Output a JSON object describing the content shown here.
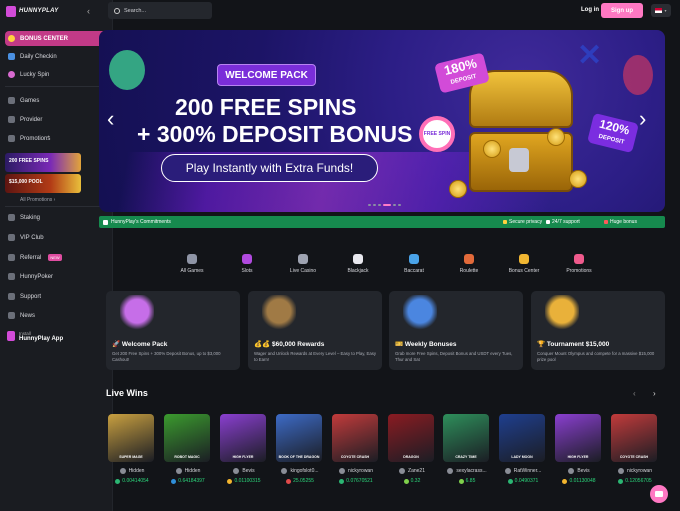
{
  "brand": {
    "name": "HUNNYPLAY"
  },
  "sidebar": {
    "top": [
      {
        "label": "BONUS CENTER"
      },
      {
        "label": "Daily Checkin"
      },
      {
        "label": "Lucky Spin"
      }
    ],
    "nav": [
      {
        "label": "Games"
      },
      {
        "label": "Provider"
      },
      {
        "label": "Promotions"
      }
    ],
    "promos": [
      {
        "label": "200 FREE SPINS"
      },
      {
        "label": "$15,000 POOL"
      }
    ],
    "all_promotions": "All Promotions",
    "bottom": [
      {
        "label": "Staking"
      },
      {
        "label": "VIP Club"
      },
      {
        "label": "Referral",
        "badge": "NEW"
      },
      {
        "label": "HunnyPoker"
      },
      {
        "label": "Support"
      },
      {
        "label": "News"
      }
    ],
    "app": {
      "line1": "Install",
      "line2": "HunnyPlay App"
    }
  },
  "topbar": {
    "search_placeholder": "Search...",
    "login": "Log in",
    "signup": "Sign up"
  },
  "banner": {
    "pack": "WELCOME PACK",
    "line1": "200 FREE SPINS",
    "line2": "+ 300% DEPOSIT BONUS",
    "cta": "Play Instantly with Extra Funds!",
    "tag1_pct": "180%",
    "tag1_sub": "DEPOSIT",
    "tag2_pct": "120%",
    "tag2_sub": "DEPOSIT",
    "spin_badge": "FREE SPIN"
  },
  "commitments": {
    "title": "HunnyPlay's Commitments",
    "items": [
      "Secure privacy",
      "24/7 support",
      "Huge bonus"
    ]
  },
  "categories": [
    {
      "label": "All Games",
      "color": "#8f95a6"
    },
    {
      "label": "Slots",
      "color": "#b14adf"
    },
    {
      "label": "Live Casino",
      "color": "#9ea3b1"
    },
    {
      "label": "Blackjack",
      "color": "#e8e8ee"
    },
    {
      "label": "Baccarat",
      "color": "#4aa3e8"
    },
    {
      "label": "Roulette",
      "color": "#e26a3a"
    },
    {
      "label": "Bonus Center",
      "color": "#f0b632"
    },
    {
      "label": "Promotions",
      "color": "#ef5a8c"
    }
  ],
  "promo_cards": [
    {
      "title": "🚀 Welcome Pack",
      "desc": "Get 200 Free Spins + 300% Deposit Bonus, up to $3,000 Cashout!",
      "color": "#c66ee8"
    },
    {
      "title": "💰💰 $60,000 Rewards",
      "desc": "Wager and Unlock Rewards at Every Level – Easy to Play, Easy to Earn!",
      "color": "#a07a45"
    },
    {
      "title": "🎫 Weekly Bonuses",
      "desc": "Grab more Free Spins, Deposit Bonus and USDT every Tues, Thur and Sat",
      "color": "#4b86e0"
    },
    {
      "title": "🏆 Tournament $15,000",
      "desc": "Conquer Mount Olympus and compete for a massive $15,000 prize pool",
      "color": "#e9b13a"
    }
  ],
  "live_wins": {
    "title": "Live Wins",
    "items": [
      {
        "game": "SUPER MAGE",
        "user": "Hidden",
        "amount": "0.00414054",
        "color": "#c9a040",
        "coin": "#2bb673"
      },
      {
        "game": "ROBOT MAGIC",
        "user": "Hidden",
        "amount": "0.64184397",
        "color": "#3b9b2e",
        "coin": "#2f8fd9"
      },
      {
        "game": "HIGH FLYER",
        "user": "Bevis",
        "amount": "0.01100315",
        "color": "#8a3fd0",
        "coin": "#f3b52e"
      },
      {
        "game": "BOOK OF THE DRAGON",
        "user": "kingofslot0...",
        "amount": "25.05255",
        "color": "#3d6bc7",
        "coin": "#e14a4a"
      },
      {
        "game": "COYOTE CRASH",
        "user": "nickyrowan",
        "amount": "0.07670521",
        "color": "#c23b3b",
        "coin": "#2bb673"
      },
      {
        "game": "DRAGON",
        "user": "Zane21",
        "amount": "0.32",
        "color": "#8a1b22",
        "coin": "#7fd14c"
      },
      {
        "game": "CRAZY TIME",
        "user": "sexylacrass...",
        "amount": "6.85",
        "color": "#2e8f5b",
        "coin": "#7fd14c"
      },
      {
        "game": "LADY MOON",
        "user": "RatWinner...",
        "amount": "0.0490371",
        "color": "#1f3f8f",
        "coin": "#2bb673"
      },
      {
        "game": "HIGH FLYER",
        "user": "Bevis",
        "amount": "0.01130048",
        "color": "#8a3fd0",
        "coin": "#f3b52e"
      },
      {
        "game": "COYOTE CRASH",
        "user": "nickyrowan",
        "amount": "0.12056705",
        "color": "#c23b3b",
        "coin": "#2bb673"
      }
    ]
  },
  "colors": {
    "accent": "#ff78c3",
    "active": "#c23a87",
    "success": "#168a4e",
    "win": "#2bd67b"
  }
}
